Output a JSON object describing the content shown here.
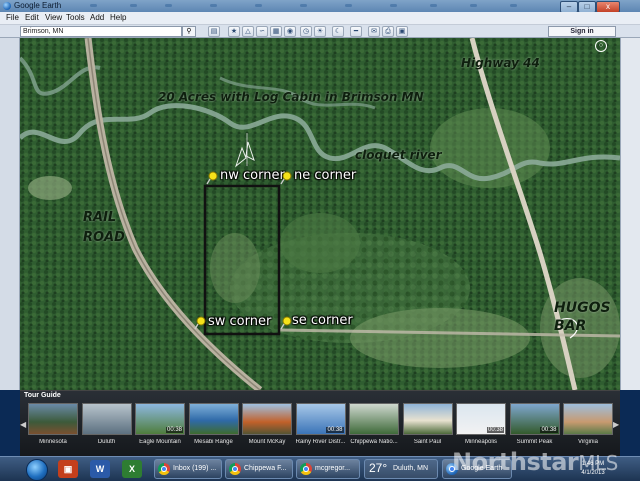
{
  "window": {
    "title": "Google Earth",
    "minimize": "–",
    "maximize": "□",
    "close": "x"
  },
  "menu": [
    "File",
    "Edit",
    "View",
    "Tools",
    "Add",
    "Help"
  ],
  "toolbar": {
    "search_value": "Brimson, MN",
    "search_icon": "search-icon",
    "signin_label": "Sign in"
  },
  "map": {
    "title_annotation": "20 Acres with Log Cabin in Brimson MN",
    "labels": {
      "highway": "Highway 44",
      "river": "cloquet river",
      "rail_line1": "RAIL",
      "rail_line2": "ROAD",
      "bar_line1": "HUGOS",
      "bar_line2": "BAR"
    },
    "corners": {
      "nw": "nw corner",
      "ne": "ne corner",
      "sw": "sw corner",
      "se": "se corner"
    },
    "colors": {
      "forest": "#2f5d30",
      "river": "#7a9a8a",
      "road": "#b8b2a3",
      "parcel_outline": "#111111",
      "pin": "#f5e21a"
    }
  },
  "tour_guide": {
    "header": "Tour Guide",
    "items": [
      {
        "label": "Minnesota",
        "duration": ""
      },
      {
        "label": "Duluth",
        "duration": ""
      },
      {
        "label": "Eagle Mountain",
        "duration": "00:38"
      },
      {
        "label": "Mesabi Range",
        "duration": ""
      },
      {
        "label": "Mount McKay",
        "duration": ""
      },
      {
        "label": "Rainy River Distr...",
        "duration": "00:38"
      },
      {
        "label": "Chippewa Natio...",
        "duration": ""
      },
      {
        "label": "Saint Paul",
        "duration": ""
      },
      {
        "label": "Minneapolis",
        "duration": "00:38"
      },
      {
        "label": "Summit Peak",
        "duration": "00:38"
      },
      {
        "label": "Virginia",
        "duration": ""
      }
    ]
  },
  "taskbar": {
    "windows": [
      {
        "label": "Inbox (199) ..."
      },
      {
        "label": "Chippewa F..."
      },
      {
        "label": "mcgregor..."
      }
    ],
    "weather_temp": "27°",
    "weather_city": "Duluth, MN",
    "google_earth_label": "Google Earth",
    "clock_time": "1:46 PM",
    "clock_date": "4/1/2013"
  },
  "watermark": {
    "brand": "Northstar",
    "suffix": "MLS"
  }
}
